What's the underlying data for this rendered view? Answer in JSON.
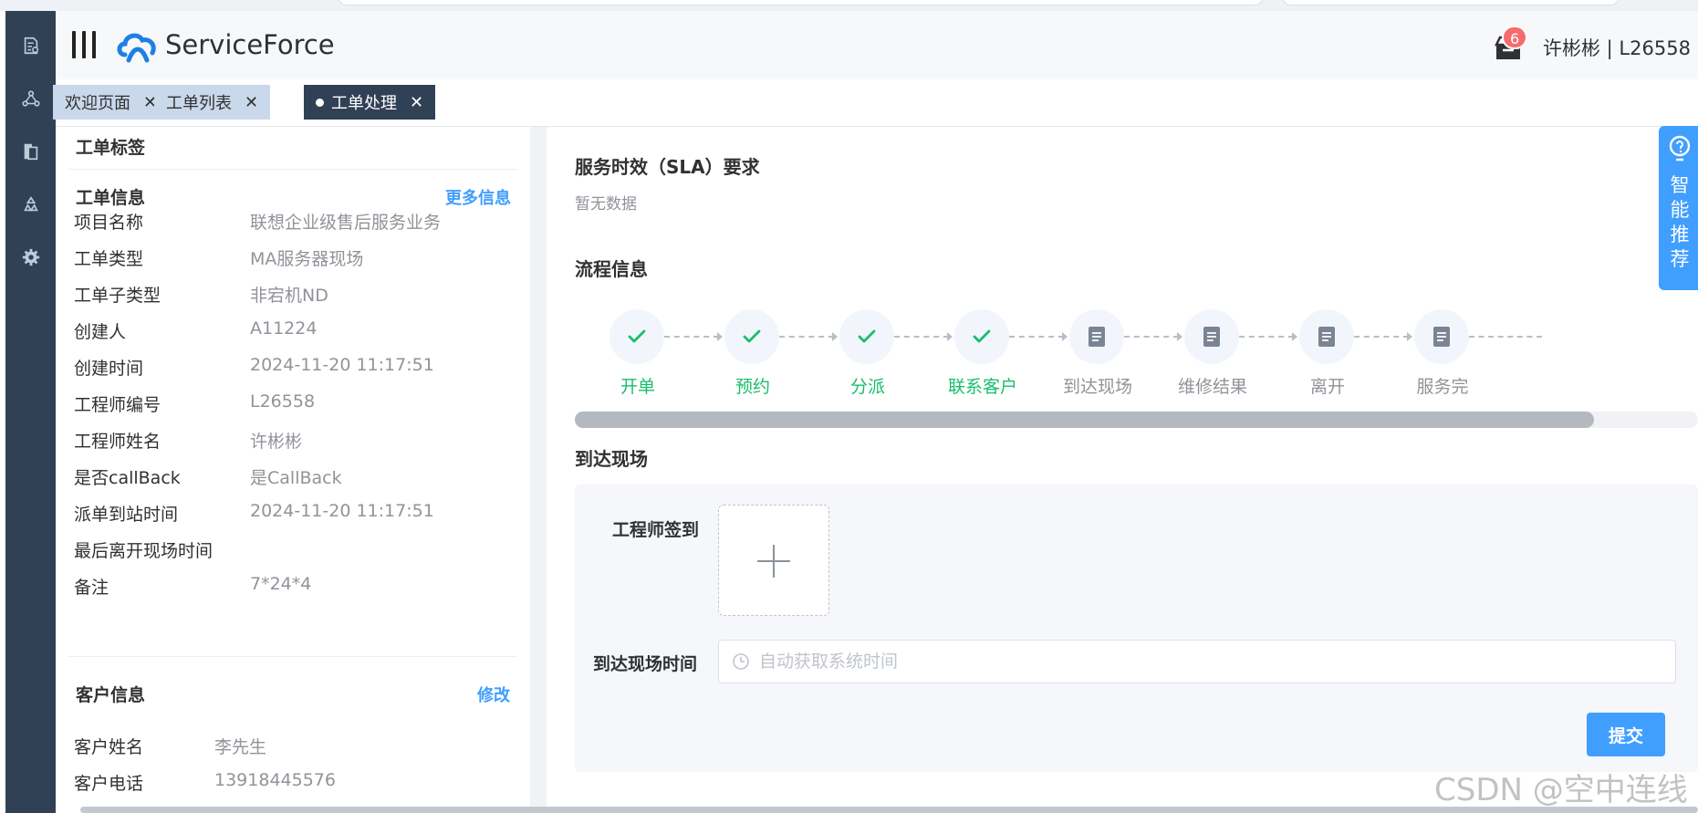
{
  "header": {
    "brand": "ServiceForce",
    "notification_count": "6",
    "user": "许彬彬 | L26558"
  },
  "tabs": [
    {
      "label": "欢迎页面",
      "active": false
    },
    {
      "label": "工单列表",
      "active": false
    },
    {
      "label": "工单处理",
      "active": true
    }
  ],
  "left": {
    "tag_title": "工单标签",
    "info_title": "工单信息",
    "more_link": "更多信息",
    "fields": [
      {
        "label": "项目名称",
        "value": "联想企业级售后服务业务"
      },
      {
        "label": "工单类型",
        "value": "MA服务器现场"
      },
      {
        "label": "工单子类型",
        "value": "非宕机ND"
      },
      {
        "label": "创建人",
        "value": "A11224"
      },
      {
        "label": "创建时间",
        "value": "2024-11-20 11:17:51"
      },
      {
        "label": "工程师编号",
        "value": "L26558"
      },
      {
        "label": "工程师姓名",
        "value": "许彬彬"
      },
      {
        "label": "是否callBack",
        "value": "是CallBack"
      },
      {
        "label": "派单到站时间",
        "value": "2024-11-20 11:17:51"
      },
      {
        "label": "最后离开现场时间",
        "value": ""
      },
      {
        "label": "备注",
        "value": "7*24*4"
      }
    ],
    "customer_title": "客户信息",
    "edit_link": "修改",
    "customer_fields": [
      {
        "label": "客户姓名",
        "value": "李先生"
      },
      {
        "label": "客户电话",
        "value": "13918445576"
      }
    ]
  },
  "right": {
    "sla_title": "服务时效（SLA）要求",
    "sla_empty": "暂无数据",
    "flow_title": "流程信息",
    "steps": [
      {
        "label": "开单",
        "status": "done"
      },
      {
        "label": "预约",
        "status": "done"
      },
      {
        "label": "分派",
        "status": "done"
      },
      {
        "label": "联系客户",
        "status": "done"
      },
      {
        "label": "到达现场",
        "status": "pending"
      },
      {
        "label": "维修结果",
        "status": "pending"
      },
      {
        "label": "离开",
        "status": "pending"
      },
      {
        "label": "服务完",
        "status": "pending"
      }
    ],
    "arrive_title": "到达现场",
    "signin_label": "工程师签到",
    "arrive_time_label": "到达现场时间",
    "arrive_time_placeholder": "自动获取系统时间",
    "submit_label": "提交"
  },
  "smart_tab": {
    "label": "智能推荐"
  },
  "watermark": "CSDN @空中连线",
  "colors": {
    "rail": "#304156",
    "accent": "#409eff",
    "success": "#19be6b",
    "badge": "#f56c6c"
  }
}
